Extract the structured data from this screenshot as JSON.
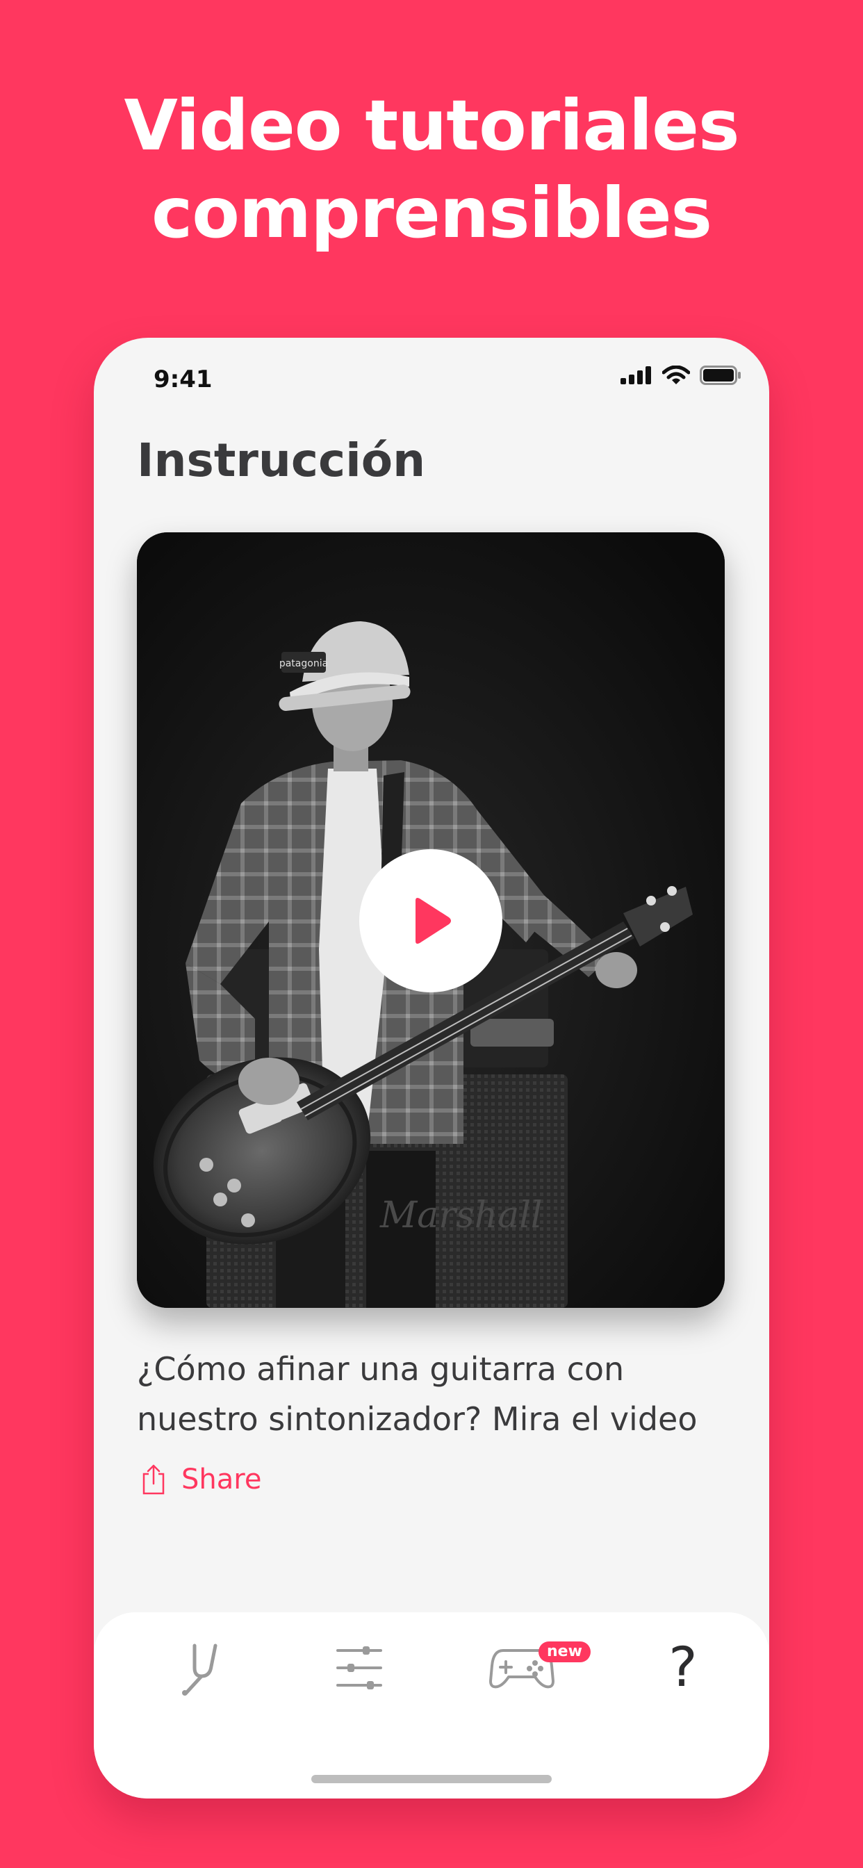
{
  "headline": {
    "line1": "Video tutoriales",
    "line2": "comprensibles"
  },
  "status_bar": {
    "time": "9:41"
  },
  "page": {
    "title": "Instrucción"
  },
  "video": {
    "caption": "¿Cómo afinar una guitarra con nuestro sintonizador? Mira el video",
    "cap_text": "patagonia",
    "amp_text": "Marshall"
  },
  "share": {
    "label": "Share"
  },
  "tab_bar": {
    "tabs": [
      {
        "name": "tuner",
        "icon": "tuning-fork-icon"
      },
      {
        "name": "settings",
        "icon": "sliders-icon"
      },
      {
        "name": "games",
        "icon": "gamepad-icon",
        "badge": "new"
      },
      {
        "name": "help",
        "icon": "question-mark-icon",
        "glyph": "?"
      }
    ]
  },
  "colors": {
    "accent": "#ff375f",
    "text": "#3a3a3c",
    "background": "#f5f5f5"
  }
}
